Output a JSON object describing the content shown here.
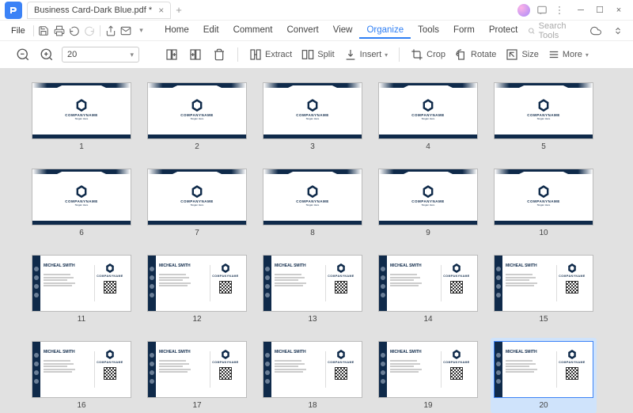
{
  "titlebar": {
    "tab_title": "Business Card-Dark Blue.pdf *"
  },
  "menubar": {
    "file": "File",
    "tabs": [
      "Home",
      "Edit",
      "Comment",
      "Convert",
      "View",
      "Organize",
      "Tools",
      "Form",
      "Protect"
    ],
    "active_index": 5,
    "search_placeholder": "Search Tools"
  },
  "toolbar": {
    "page_value": "20",
    "extract": "Extract",
    "split": "Split",
    "insert": "Insert",
    "crop": "Crop",
    "rotate": "Rotate",
    "size": "Size",
    "more": "More"
  },
  "card": {
    "company": "COMPANYNAME",
    "slogan": "Slogan Here",
    "name": "MICHEAL SMITH"
  },
  "pages": {
    "count": 20,
    "front_through": 10,
    "selected": 20
  }
}
